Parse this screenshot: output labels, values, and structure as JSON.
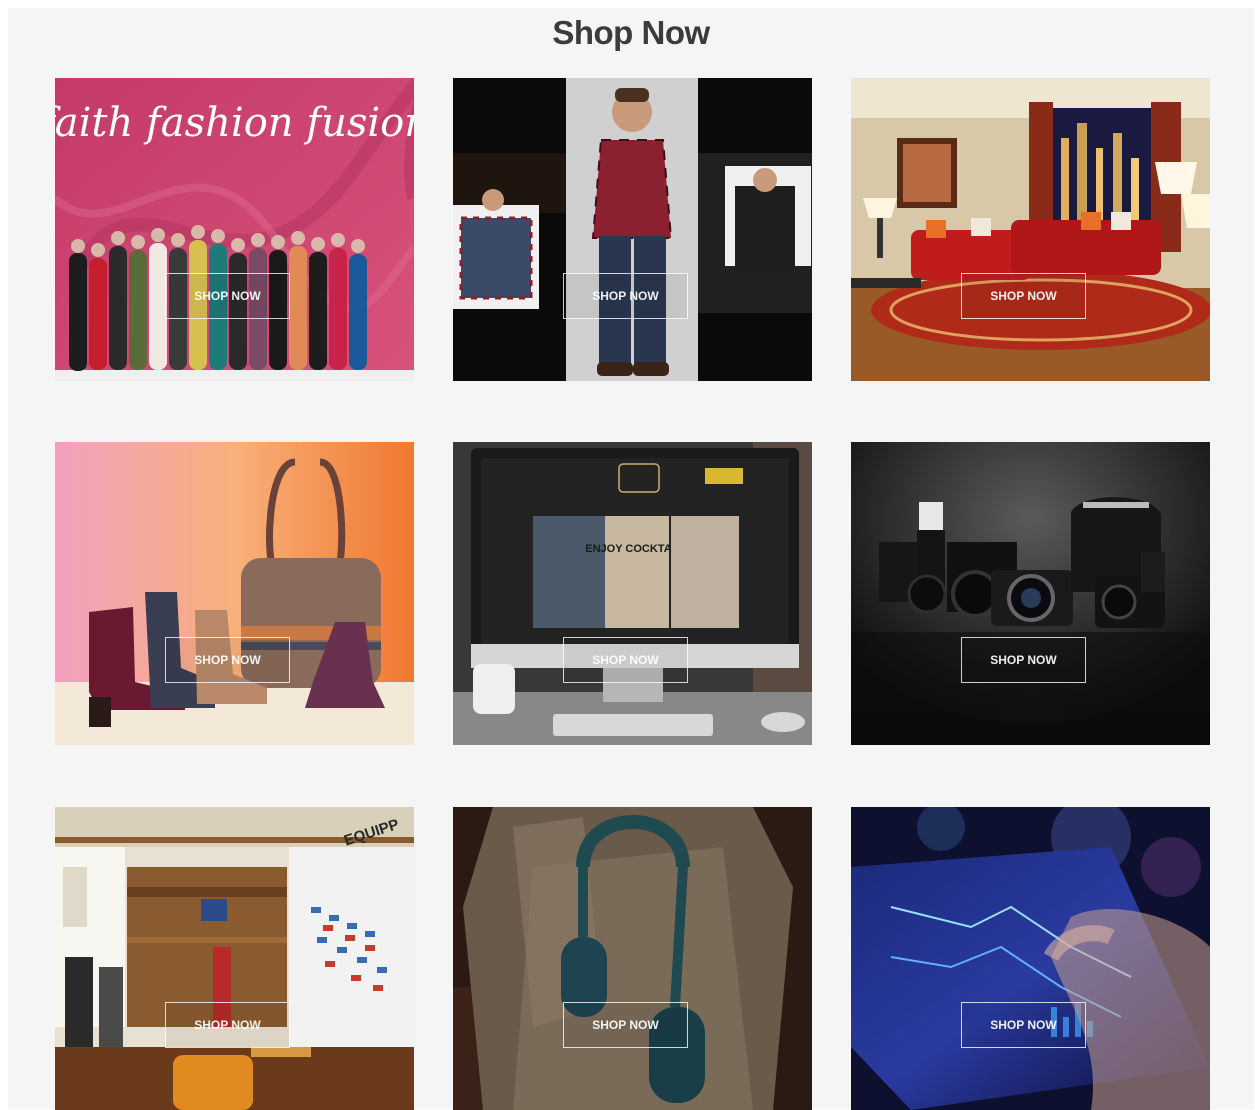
{
  "page": {
    "title": "Shop Now",
    "background": "#f5f5f5",
    "title_color": "#3b3b3b"
  },
  "tiles": [
    {
      "id": "fashion",
      "image_text": "faith fashion fusion",
      "button_label": "SHOP NOW"
    },
    {
      "id": "menswear",
      "button_label": "SHOP NOW"
    },
    {
      "id": "home-interior",
      "button_label": "SHOP NOW"
    },
    {
      "id": "shoes-bags",
      "button_label": "SHOP NOW"
    },
    {
      "id": "website-mockup",
      "screen_text": "ENJOY COCKTAILS",
      "button_label": "SHOP NOW"
    },
    {
      "id": "cameras",
      "button_label": "SHOP NOW"
    },
    {
      "id": "sports-store",
      "button_label": "SHOP NOW"
    },
    {
      "id": "headphones",
      "button_label": "SHOP NOW"
    },
    {
      "id": "mobile-tablet",
      "button_label": "SHOP NOW"
    }
  ]
}
